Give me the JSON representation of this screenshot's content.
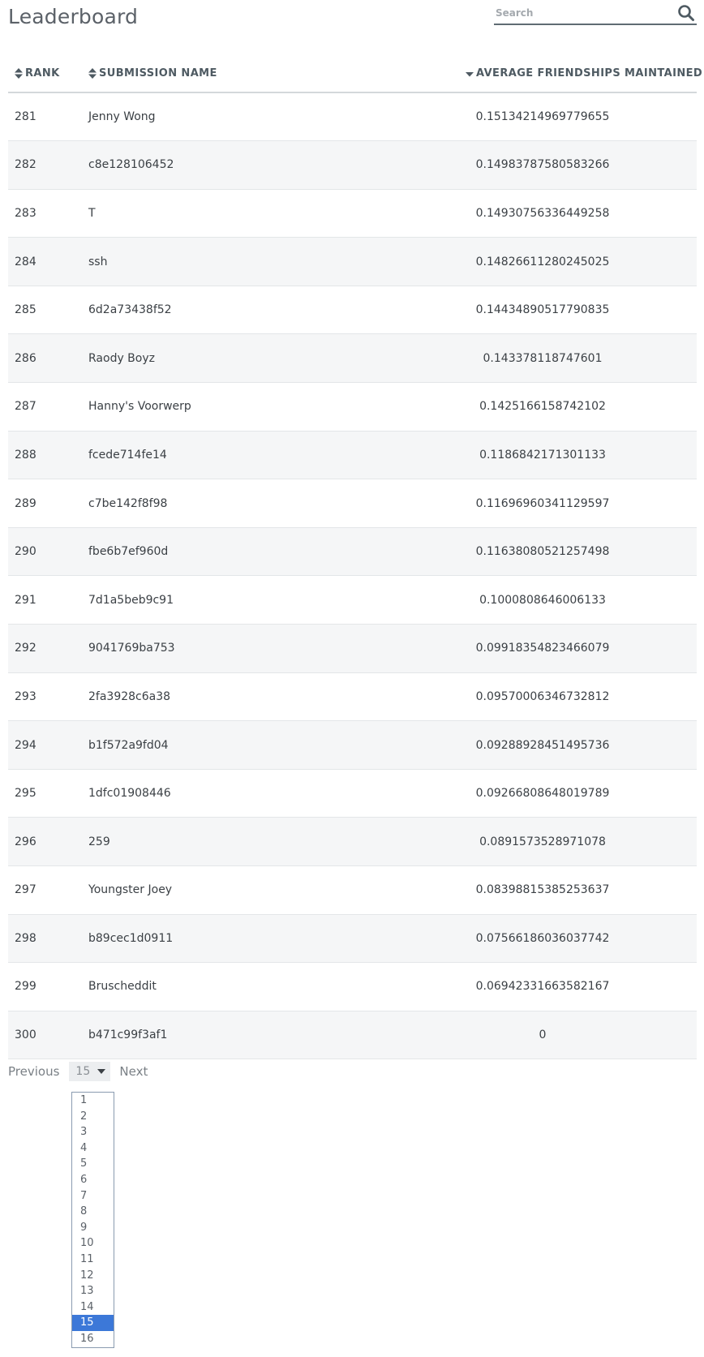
{
  "header": {
    "title": "Leaderboard",
    "search_placeholder": "Search"
  },
  "table": {
    "columns": {
      "rank": "RANK",
      "name": "SUBMISSION NAME",
      "score": "AVERAGE FRIENDSHIPS MAINTAINED"
    },
    "sort": {
      "column": "score",
      "direction": "desc"
    },
    "rows": [
      {
        "rank": "281",
        "name": "Jenny Wong",
        "score": "0.15134214969779655"
      },
      {
        "rank": "282",
        "name": "c8e128106452",
        "score": "0.14983787580583266"
      },
      {
        "rank": "283",
        "name": "T",
        "score": "0.14930756336449258"
      },
      {
        "rank": "284",
        "name": "ssh",
        "score": "0.14826611280245025"
      },
      {
        "rank": "285",
        "name": "6d2a73438f52",
        "score": "0.14434890517790835"
      },
      {
        "rank": "286",
        "name": "Raody Boyz",
        "score": "0.143378118747601"
      },
      {
        "rank": "287",
        "name": "Hanny's Voorwerp",
        "score": "0.1425166158742102"
      },
      {
        "rank": "288",
        "name": "fcede714fe14",
        "score": "0.1186842171301133"
      },
      {
        "rank": "289",
        "name": "c7be142f8f98",
        "score": "0.11696960341129597"
      },
      {
        "rank": "290",
        "name": "fbe6b7ef960d",
        "score": "0.11638080521257498"
      },
      {
        "rank": "291",
        "name": "7d1a5beb9c91",
        "score": "0.1000808646006133"
      },
      {
        "rank": "292",
        "name": "9041769ba753",
        "score": "0.09918354823466079"
      },
      {
        "rank": "293",
        "name": "2fa3928c6a38",
        "score": "0.09570006346732812"
      },
      {
        "rank": "294",
        "name": "b1f572a9fd04",
        "score": "0.09288928451495736"
      },
      {
        "rank": "295",
        "name": "1dfc01908446",
        "score": "0.09266808648019789"
      },
      {
        "rank": "296",
        "name": "259",
        "score": "0.0891573528971078"
      },
      {
        "rank": "297",
        "name": "Youngster Joey",
        "score": "0.08398815385253637"
      },
      {
        "rank": "298",
        "name": "b89cec1d0911",
        "score": "0.07566186036037742"
      },
      {
        "rank": "299",
        "name": "Bruscheddit",
        "score": "0.06942331663582167"
      },
      {
        "rank": "300",
        "name": "b471c99f3af1",
        "score": "0"
      }
    ]
  },
  "pagination": {
    "previous_label": "Previous",
    "next_label": "Next",
    "current_page": "15",
    "page_options": [
      "1",
      "2",
      "3",
      "4",
      "5",
      "6",
      "7",
      "8",
      "9",
      "10",
      "11",
      "12",
      "13",
      "14",
      "15",
      "16"
    ]
  },
  "colors": {
    "selected_option_bg": "#3c78d8",
    "stripe_bg": "#f5f6f7"
  },
  "icons": {
    "search": "search-icon",
    "sort_unsorted": "sort-both-icon",
    "sort_desc": "sort-desc-icon",
    "caret": "chevron-down-icon"
  }
}
